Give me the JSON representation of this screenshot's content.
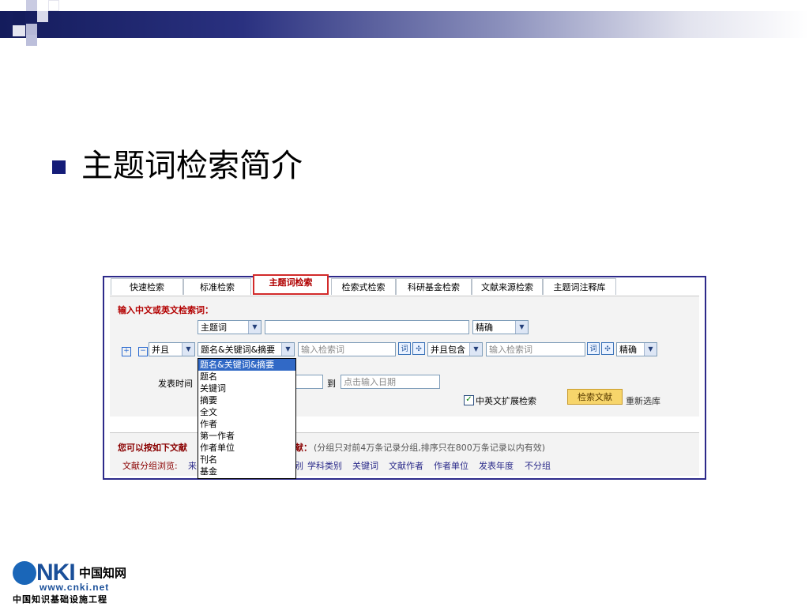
{
  "slide": {
    "title": "主题词检索简介",
    "colors": {
      "header_dark": "#141c5c",
      "bullet": "#141c78",
      "frame": "#2d2a8a",
      "active_tab": "#d22a2a",
      "label_red": "#b30000"
    }
  },
  "tabs": [
    {
      "label": "快速检索"
    },
    {
      "label": "标准检索"
    },
    {
      "label": "主题词检索",
      "active": true
    },
    {
      "label": "检索式检索"
    },
    {
      "label": "科研基金检索"
    },
    {
      "label": "文献来源检索"
    },
    {
      "label": "主题词注释库"
    }
  ],
  "search": {
    "prompt": "输入中文或英文检索词：",
    "field1": "主题词",
    "match1": "精确",
    "logic": "并且",
    "field2": "题名&关键词&摘要",
    "placeholder1": "输入检索词",
    "contain": "并且包含",
    "placeholder2": "输入检索词",
    "match2": "精确",
    "date_label": "发表时间",
    "date_to": "到",
    "date_placeholder": "点击输入日期",
    "expand_label": "中英文扩展检索",
    "search_button": "检索文献",
    "reset": "重新选库"
  },
  "dropdown_options": [
    {
      "label": "题名&关键词&摘要",
      "selected": true
    },
    {
      "label": "题名"
    },
    {
      "label": "关键词"
    },
    {
      "label": "摘要"
    },
    {
      "label": "全文"
    },
    {
      "label": "作者"
    },
    {
      "label": "第一作者"
    },
    {
      "label": "作者单位"
    },
    {
      "label": "刊名"
    },
    {
      "label": "基金"
    }
  ],
  "grouping": {
    "intro_left": "您可以按如下文献",
    "intro_right": "献：",
    "note": "(分组只对前4万条记录分组,排序只在800万条记录以内有效)",
    "browse_label": "文献分组浏览:",
    "partial_a": "来",
    "partial_b": "别",
    "links": [
      "学科类别",
      "关键词",
      "文献作者",
      "作者单位",
      "发表年度",
      "不分组"
    ]
  },
  "logo": {
    "brand": "NKI",
    "cn": "中国知网",
    "url": "www.cnki.net",
    "subtitle": "中国知识基础设施工程"
  }
}
